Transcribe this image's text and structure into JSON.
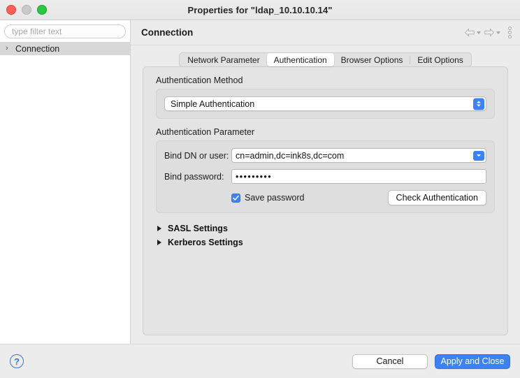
{
  "window": {
    "title": "Properties for \"ldap_10.10.10.14\"",
    "traffic_lights": [
      "close",
      "minimize",
      "zoom"
    ]
  },
  "sidebar": {
    "filter_placeholder": "type filter text",
    "filter_value": "",
    "items": [
      {
        "label": "Connection",
        "selected": true,
        "arrow": "chevron-right-icon"
      }
    ]
  },
  "header": {
    "title": "Connection",
    "back_icon": "arrow-left-icon",
    "forward_icon": "arrow-right-icon",
    "menu_icon": "kebab-menu-icon"
  },
  "tabs": [
    {
      "label": "Network Parameter",
      "active": false
    },
    {
      "label": "Authentication",
      "active": true
    },
    {
      "label": "Browser Options",
      "active": false
    },
    {
      "label": "Edit Options",
      "active": false
    }
  ],
  "auth_method": {
    "group_label": "Authentication Method",
    "selected": "Simple Authentication",
    "icon": "popup-chevrons-icon"
  },
  "auth_parameter": {
    "group_label": "Authentication Parameter",
    "bind_dn": {
      "label": "Bind DN or user:",
      "value": "cn=admin,dc=ink8s,dc=com",
      "icon": "chevron-down-icon"
    },
    "bind_password": {
      "label": "Bind password:",
      "value": "•••••••••"
    },
    "save_password": {
      "label": "Save password",
      "checked": true,
      "check_glyph": "✓"
    },
    "check_auth_button": "Check Authentication"
  },
  "sections": [
    {
      "label": "SASL Settings",
      "expanded": false,
      "icon": "triangle-right-icon"
    },
    {
      "label": "Kerberos Settings",
      "expanded": false,
      "icon": "triangle-right-icon"
    }
  ],
  "footer": {
    "help_icon": "?",
    "cancel_label": "Cancel",
    "apply_label": "Apply and Close"
  },
  "colors": {
    "accent": "#3b82f6",
    "window_bg": "#ececec",
    "panel_bg": "#e4e4e4",
    "group_bg": "#dedede",
    "sidebar_bg": "#ffffff",
    "selection_bg": "#d8d8d8",
    "help_blue": "#3b76c9",
    "traffic_red": "#ff5f57",
    "traffic_gray": "#c9c9c9",
    "traffic_green": "#28c840"
  }
}
